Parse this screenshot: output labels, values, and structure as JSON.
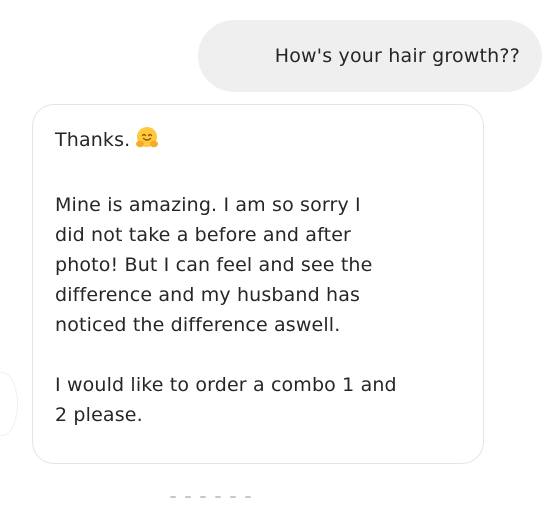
{
  "conversation": {
    "outgoing_message": "How's your hair growth??",
    "incoming_message": {
      "greeting": "Thanks.",
      "greeting_emoji": "hugging-face-icon",
      "paragraph_1": "Mine is amazing. I am so sorry I\ndid not take a before and after\nphoto! But I can feel and see the\ndifference and my husband has\nnoticed the difference aswell.",
      "paragraph_2": "I would like to order a combo 1 and\n2 please."
    }
  },
  "colors": {
    "outgoing_bubble_bg": "#efefef",
    "incoming_bubble_border": "#e4e4e4",
    "text": "#262626",
    "emoji_face": "#ffc83d"
  }
}
